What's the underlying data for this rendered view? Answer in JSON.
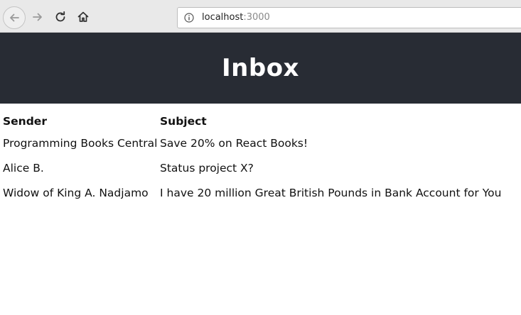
{
  "browser": {
    "url_host": "localhost",
    "url_port": ":3000",
    "icons": {
      "back": "arrow-left-icon",
      "forward": "arrow-right-icon",
      "reload": "reload-icon",
      "home": "home-icon",
      "info": "info-icon",
      "cursor": "mouse-cursor-icon"
    }
  },
  "header": {
    "title": "Inbox",
    "background": "#282c34"
  },
  "table": {
    "columns": [
      "Sender",
      "Subject"
    ],
    "rows": [
      {
        "sender": "Programming Books Central",
        "subject": "Save 20% on React Books!"
      },
      {
        "sender": "Alice B.",
        "subject": "Status project X?"
      },
      {
        "sender": "Widow of King A. Nadjamo",
        "subject": "I have 20 million Great British Pounds in Bank Account for You"
      }
    ]
  }
}
